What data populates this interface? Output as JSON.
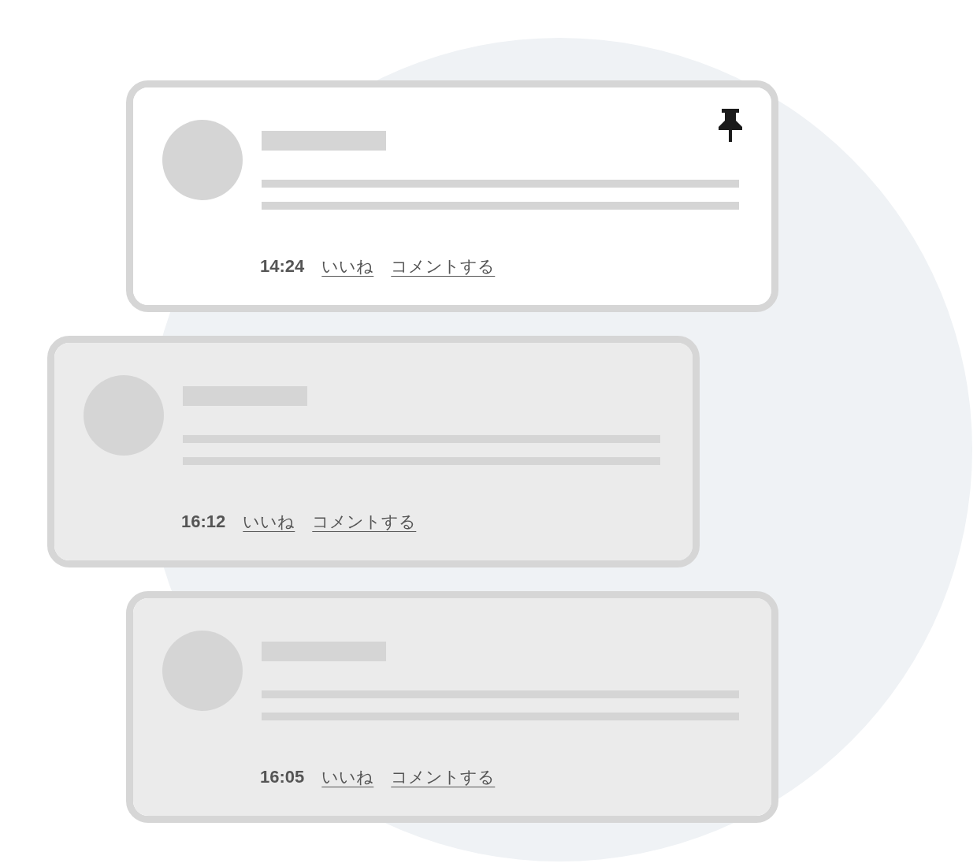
{
  "posts": [
    {
      "time": "14:24",
      "highlighted": true,
      "pinned": true,
      "actions": [
        "いいね",
        "コメントする"
      ]
    },
    {
      "time": "16:12",
      "highlighted": false,
      "pinned": false,
      "actions": [
        "いいね",
        "コメントする"
      ]
    },
    {
      "time": "16:05",
      "highlighted": false,
      "pinned": false,
      "actions": [
        "いいね",
        "コメントする"
      ]
    }
  ]
}
